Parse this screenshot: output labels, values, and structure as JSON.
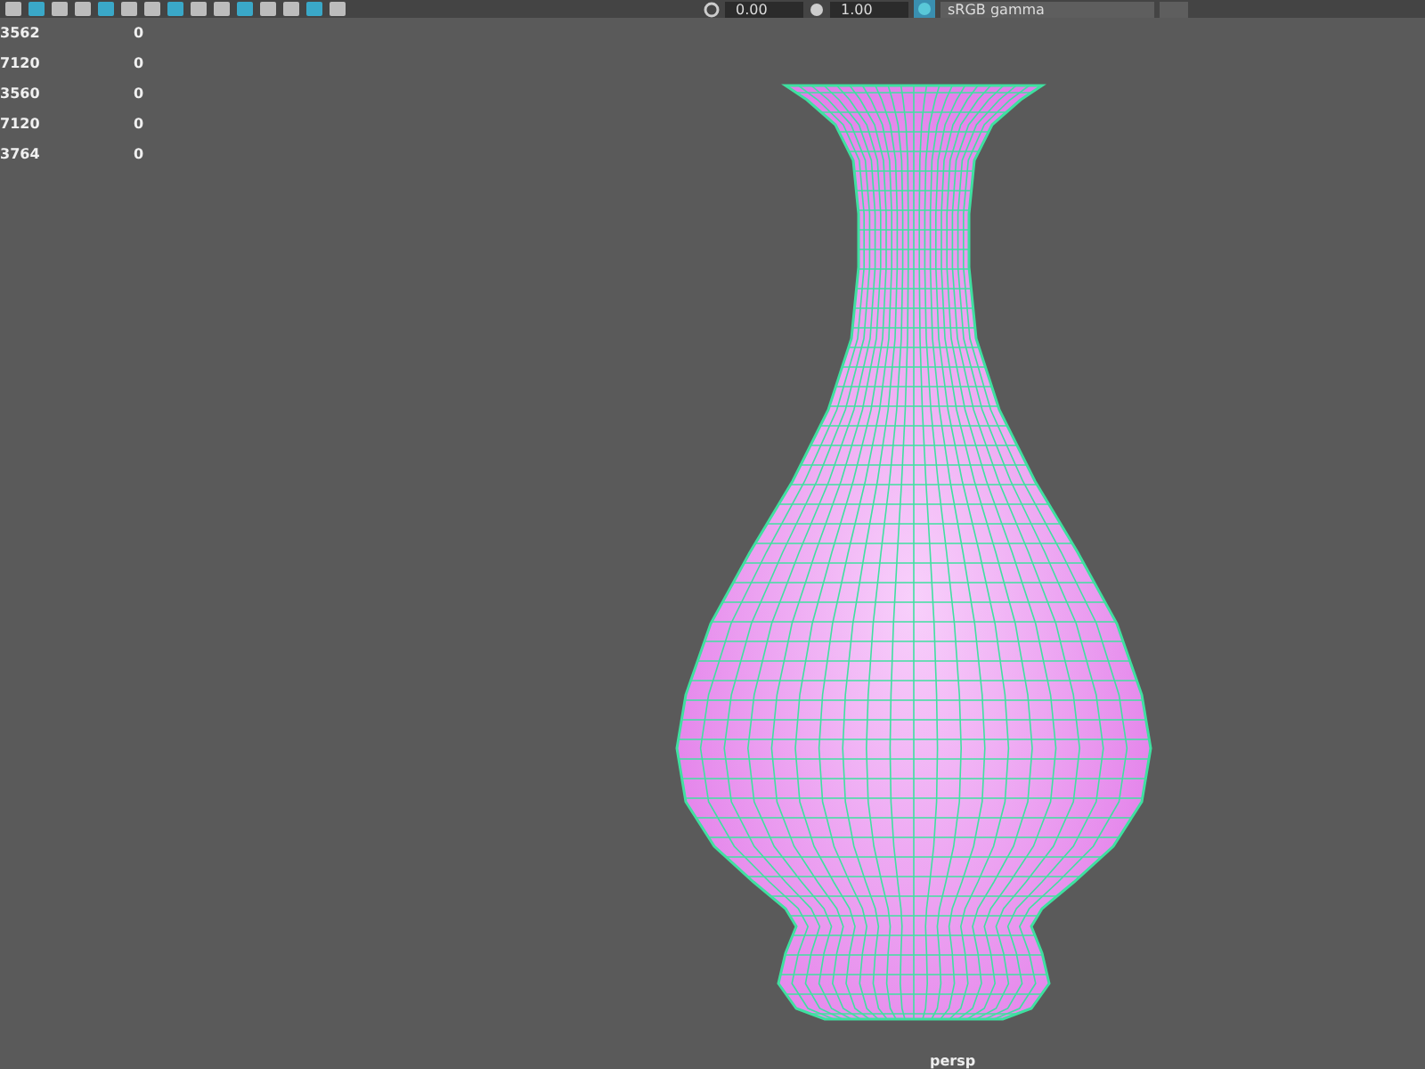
{
  "toolbar": {
    "exposure": "0.00",
    "gamma": "1.00",
    "color_space": "sRGB gamma"
  },
  "stats": [
    {
      "value": "3562",
      "column_2": "0"
    },
    {
      "value": "7120",
      "column_2": "0"
    },
    {
      "value": "3560",
      "column_2": "0"
    },
    {
      "value": "7120",
      "column_2": "0"
    },
    {
      "value": "3764",
      "column_2": "0"
    }
  ],
  "viewport": {
    "camera": "persp"
  }
}
